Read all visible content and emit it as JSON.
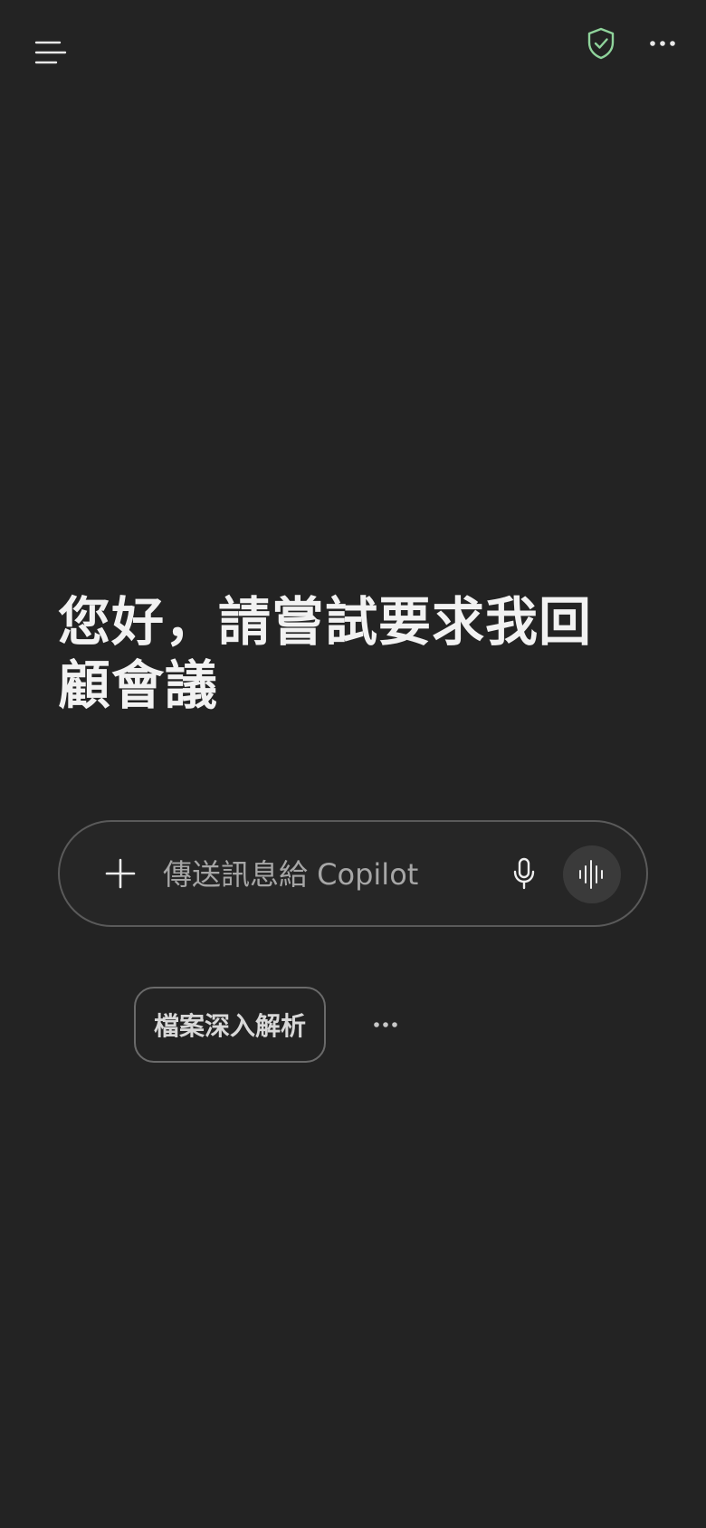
{
  "header": {
    "menu_icon": "menu-icon",
    "shield_icon": "shield-check-icon",
    "more_icon": "more-horizontal-icon"
  },
  "greeting": "您好，請嘗試要求我回顧會議",
  "composer": {
    "placeholder": "傳送訊息給 Copilot",
    "value": "",
    "add_icon": "plus-icon",
    "mic_icon": "microphone-icon",
    "voice_icon": "voice-waveform-icon"
  },
  "suggestions": {
    "chip_label": "檔案深入解析",
    "more_icon": "more-horizontal-icon"
  },
  "colors": {
    "background": "#232323",
    "text": "#f2f2f2",
    "placeholder": "#a6a6a6",
    "border": "#5a5a5a",
    "shield_accent": "#8fd39b",
    "voice_button_bg": "#3a3a3a"
  }
}
